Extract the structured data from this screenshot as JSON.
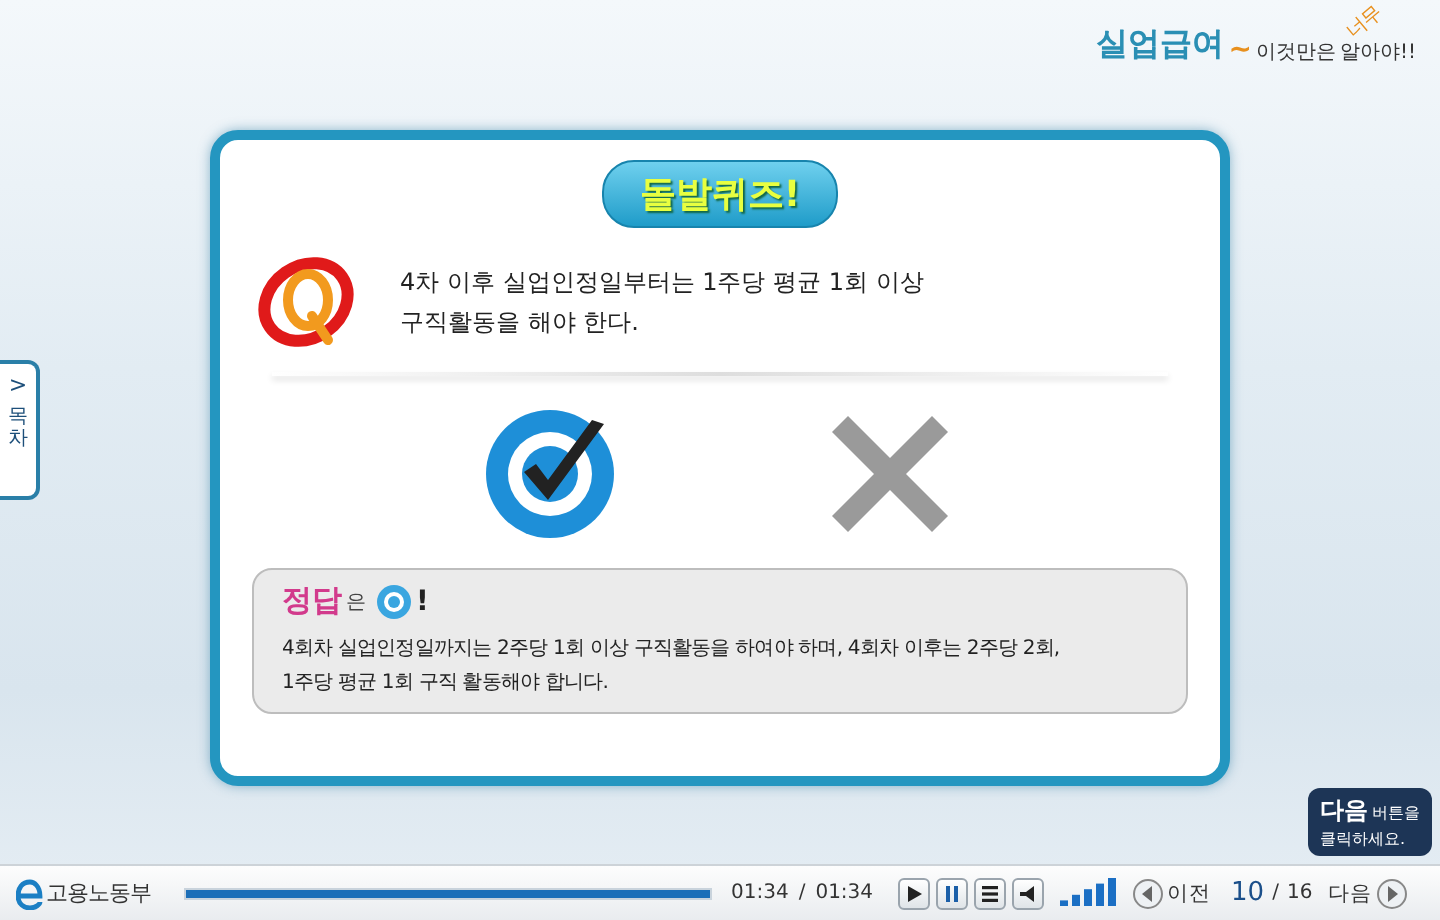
{
  "logo": {
    "title": "실업급여",
    "tilde": "~",
    "subtitle_start": "이것만은",
    "subtitle_note": "너무",
    "subtitle_end": "알아야!!"
  },
  "side_tab": {
    "arrow": ">",
    "label": "목차"
  },
  "quiz": {
    "title": "돌발퀴즈!",
    "question_lines": [
      "4차 이후 실업인정일부터는 1주당 평균 1회 이상",
      "구직활동을 해야 한다."
    ],
    "options": [
      {
        "kind": "o",
        "selected": true
      },
      {
        "kind": "x",
        "selected": false
      }
    ],
    "answer": {
      "label": "정답",
      "particle": "은",
      "exclaim": "!",
      "explanation_lines": [
        "4회차 실업인정일까지는 2주당 1회 이상 구직활동을 하여야 하며, 4회차 이후는 2주당 2회,",
        "1주당 평균 1회 구직 활동해야 합니다."
      ]
    }
  },
  "tooltip": {
    "strong": "다음",
    "rest": "버튼을",
    "line2": "클릭하세요."
  },
  "player": {
    "brand": "고용노동부",
    "progress": {
      "level": 1.0
    },
    "time_current": "01:34",
    "time_separator": "/",
    "time_total": "01:34",
    "page": {
      "prev": "이전",
      "current": "10",
      "separator": "/",
      "total": "16",
      "next": "다음"
    }
  }
}
